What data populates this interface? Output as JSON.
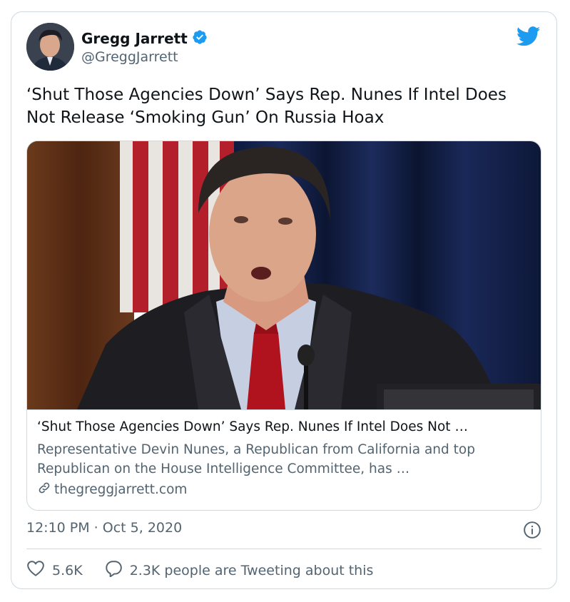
{
  "author": {
    "name": "Gregg Jarrett",
    "handle": "@GreggJarrett",
    "verified": true
  },
  "tweet": {
    "text": "‘Shut Those Agencies Down’ Says Rep. Nunes If Intel Does Not Release ‘Smoking Gun’ On Russia Hoax",
    "timestamp": "12:10 PM · Oct 5, 2020"
  },
  "card": {
    "title": "‘Shut Those Agencies Down’  Says Rep. Nunes If Intel Does Not …",
    "description": "Representative Devin Nunes, a Republican from California and top Republican on the House Intelligence Committee, has …",
    "domain": "thegreggjarrett.com"
  },
  "actions": {
    "likes": "5.6K",
    "conversation": "2.3K people are Tweeting about this"
  },
  "colors": {
    "brand_blue": "#1d9bf0",
    "secondary_text": "#536471",
    "border": "#cfd9de"
  },
  "icons": [
    "verified-badge-icon",
    "twitter-bird-icon",
    "link-icon",
    "info-icon",
    "heart-icon",
    "reply-bubble-icon"
  ]
}
